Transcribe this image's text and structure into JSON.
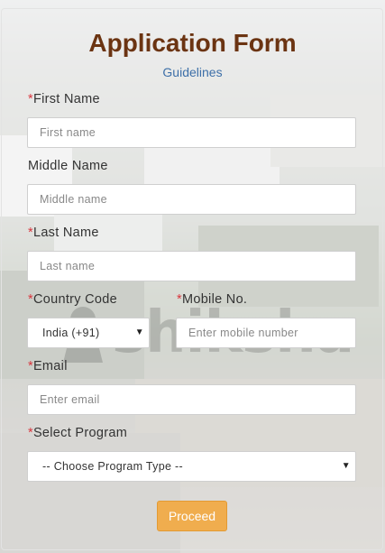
{
  "form": {
    "title": "Application Form",
    "guidelines_link": "Guidelines",
    "required_marker": "*",
    "first_name": {
      "label": "First Name",
      "placeholder": "First name",
      "required": true
    },
    "middle_name": {
      "label": "Middle Name",
      "placeholder": "Middle name",
      "required": false
    },
    "last_name": {
      "label": "Last Name",
      "placeholder": "Last name",
      "required": true
    },
    "country_code": {
      "label": "Country Code",
      "value": "India (+91)",
      "required": true
    },
    "mobile": {
      "label": "Mobile No.",
      "placeholder": "Enter mobile number",
      "required": true
    },
    "email": {
      "label": "Email",
      "placeholder": "Enter email",
      "required": true
    },
    "program": {
      "label": "Select Program",
      "value": "-- Choose Program Type --",
      "required": true
    },
    "proceed_button": "Proceed"
  },
  "watermark": {
    "text": "shiksha"
  },
  "colors": {
    "title": "#6b3412",
    "link": "#3d6fa8",
    "required": "#d9363e",
    "button": "#f0ad4e"
  },
  "icons": {
    "dropdown": "caret-down-icon"
  }
}
